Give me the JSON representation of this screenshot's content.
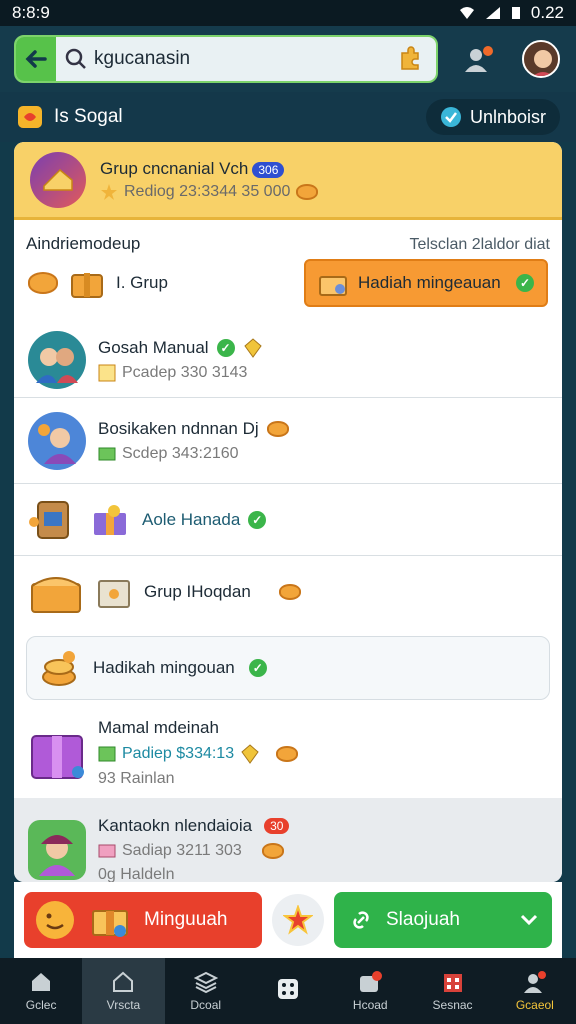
{
  "statusbar": {
    "time": "8:8:9",
    "battery": "0.22"
  },
  "search": {
    "value": "kgucanasin"
  },
  "subbar": {
    "title": "Is Sogal",
    "unblock_label": "Unlnboisr"
  },
  "featured": {
    "name": "Grup cncnanial Vch",
    "badge": "306",
    "sub": "Rediog 23:3344 35 000"
  },
  "listhead": {
    "left": "Aindriemodeup",
    "right": "Telsclan 2laldor diat"
  },
  "grup_row": {
    "label": "I. Grup",
    "button": "Hadiah mingeauan"
  },
  "rows": [
    {
      "name": "Gosah Manual",
      "sub": "Pcadep 330 3143"
    },
    {
      "name": "Bosikaken ndnnan Dj",
      "sub": "Scdep 343:2160"
    },
    {
      "name": "Aole Hanada"
    },
    {
      "name": "Grup IHoqdan"
    }
  ],
  "hadiah_card": {
    "label": "Hadikah mingouan"
  },
  "marnal": {
    "name": "Mamal mdeinah",
    "sub": "Padiep $334:13",
    "extra": "93 Rainlan"
  },
  "kantaokn": {
    "name": "Kantaokn nlendaioia",
    "badge": "30",
    "sub": "Sadiap 3211 303",
    "extra": "0g Haldeln"
  },
  "actions": {
    "left": "Minguuah",
    "right": "Slaojuah"
  },
  "navbar": [
    {
      "label": "Gclec"
    },
    {
      "label": "Vrscta"
    },
    {
      "label": "Dcoal"
    },
    {
      "label": ""
    },
    {
      "label": "Hcoad"
    },
    {
      "label": "Sesnac"
    },
    {
      "label": "Gcaeol"
    }
  ],
  "colors": {
    "accent_green": "#2fb34a",
    "accent_red": "#e8402c",
    "accent_orange": "#f79a33",
    "featured_bg": "#f8d168",
    "bar_bg": "#153b4c"
  }
}
